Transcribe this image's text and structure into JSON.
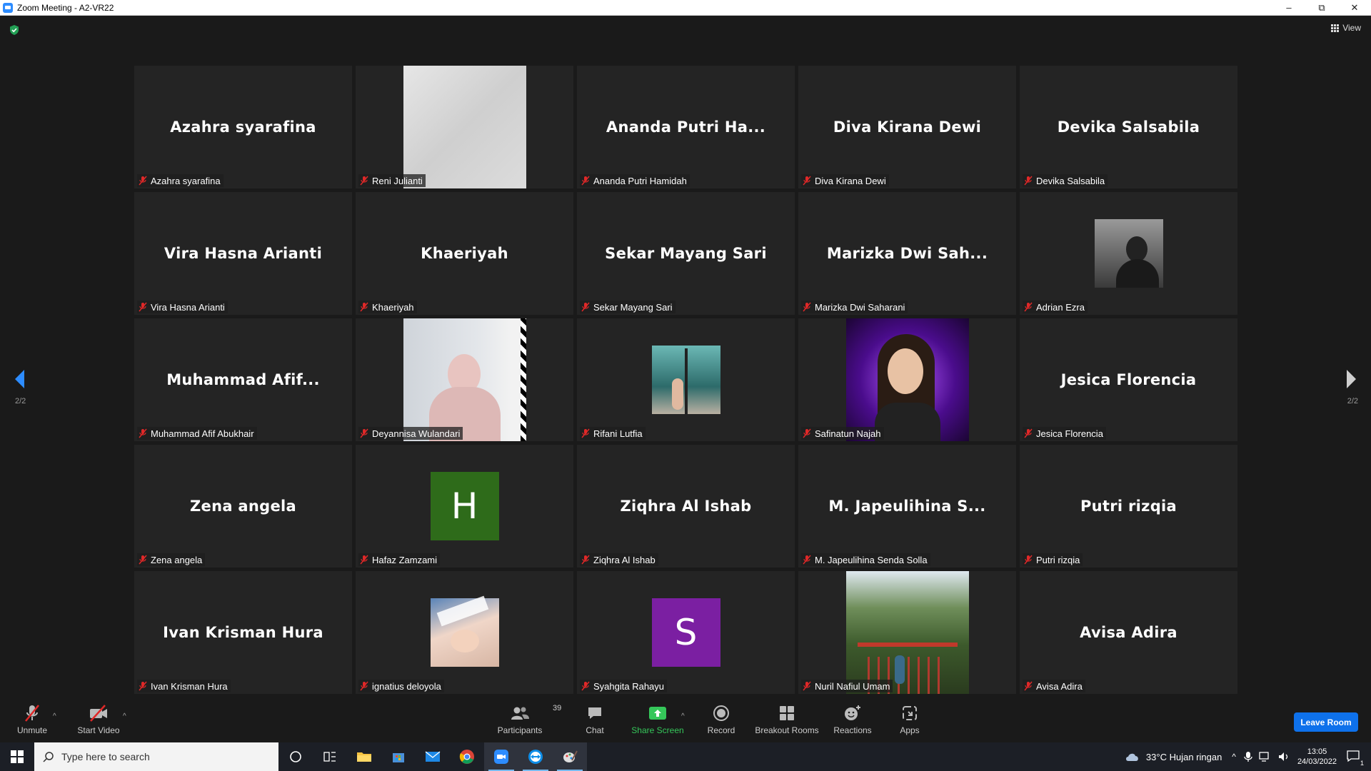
{
  "window": {
    "title": "Zoom Meeting - A2-VR22",
    "minimize": "–",
    "restore": "⧉",
    "close": "✕"
  },
  "meeting": {
    "view_label": "View",
    "page_left": "2/2",
    "page_right": "2/2",
    "participants": [
      {
        "name": "Azahra syarafina",
        "display": "Azahra syarafina",
        "video": "none"
      },
      {
        "name": "Reni Julianti",
        "display": "",
        "video": "photo-light"
      },
      {
        "name": "Ananda Putri Hamidah",
        "display": "Ananda Putri Ha...",
        "video": "none"
      },
      {
        "name": "Diva Kirana Dewi",
        "display": "Diva Kirana Dewi",
        "video": "none"
      },
      {
        "name": "Devika Salsabila",
        "display": "Devika Salsabila",
        "video": "none"
      },
      {
        "name": "Vira Hasna Arianti",
        "display": "Vira Hasna Arianti",
        "video": "none"
      },
      {
        "name": "Khaeriyah",
        "display": "Khaeriyah",
        "video": "none"
      },
      {
        "name": "Sekar Mayang Sari",
        "display": "Sekar Mayang Sari",
        "video": "none"
      },
      {
        "name": "Marizka Dwi Saharani",
        "display": "Marizka Dwi Sah...",
        "video": "none"
      },
      {
        "name": "Adrian Ezra",
        "display": "",
        "video": "avatar-bw"
      },
      {
        "name": "Muhammad Afif Abukhair",
        "display": "Muhammad  Afif...",
        "video": "none"
      },
      {
        "name": "Deyannisa Wulandari",
        "display": "",
        "video": "photo-hijab"
      },
      {
        "name": "Rifani Lutfia",
        "display": "",
        "video": "avatar-window"
      },
      {
        "name": "Safinatun Najah",
        "display": "",
        "video": "photo-purple"
      },
      {
        "name": "Jesica Florencia",
        "display": "Jesica Florencia",
        "video": "none"
      },
      {
        "name": "Zena angela",
        "display": "Zena angela",
        "video": "none"
      },
      {
        "name": "Hafaz Zamzami",
        "display": "",
        "video": "letter-H"
      },
      {
        "name": "Ziqhra Al Ishab",
        "display": "Ziqhra Al Ishab",
        "video": "none"
      },
      {
        "name": "M. Japeulihina Senda Solla",
        "display": "M. Japeulihina S...",
        "video": "none"
      },
      {
        "name": "Putri rizqia",
        "display": "Putri rizqia",
        "video": "none"
      },
      {
        "name": "Ivan Krisman Hura",
        "display": "Ivan Krisman Hura",
        "video": "none"
      },
      {
        "name": "ignatius deloyola",
        "display": "",
        "video": "avatar-baby"
      },
      {
        "name": "Syahgita Rahayu",
        "display": "",
        "video": "letter-S"
      },
      {
        "name": "Nuril Nafiul Umam",
        "display": "",
        "video": "photo-forest"
      },
      {
        "name": "Avisa Adira",
        "display": "Avisa Adira",
        "video": "none"
      }
    ]
  },
  "letters": {
    "H": "H",
    "S": "S"
  },
  "colors": {
    "accent_blue": "#0e71eb",
    "share_green": "#35c75a",
    "muted_red": "#e02828",
    "avatar_H": "#2e6b1a",
    "avatar_S": "#7b1fa2"
  },
  "toolbar": {
    "unmute": "Unmute",
    "start_video": "Start Video",
    "participants": "Participants",
    "participants_count": "39",
    "chat": "Chat",
    "share_screen": "Share Screen",
    "record": "Record",
    "breakout_rooms": "Breakout Rooms",
    "reactions": "Reactions",
    "apps": "Apps",
    "leave_room": "Leave Room"
  },
  "taskbar": {
    "search_placeholder": "Type here to search",
    "weather": "33°C  Hujan ringan",
    "time": "13:05",
    "date": "24/03/2022",
    "notification_count": "1"
  }
}
